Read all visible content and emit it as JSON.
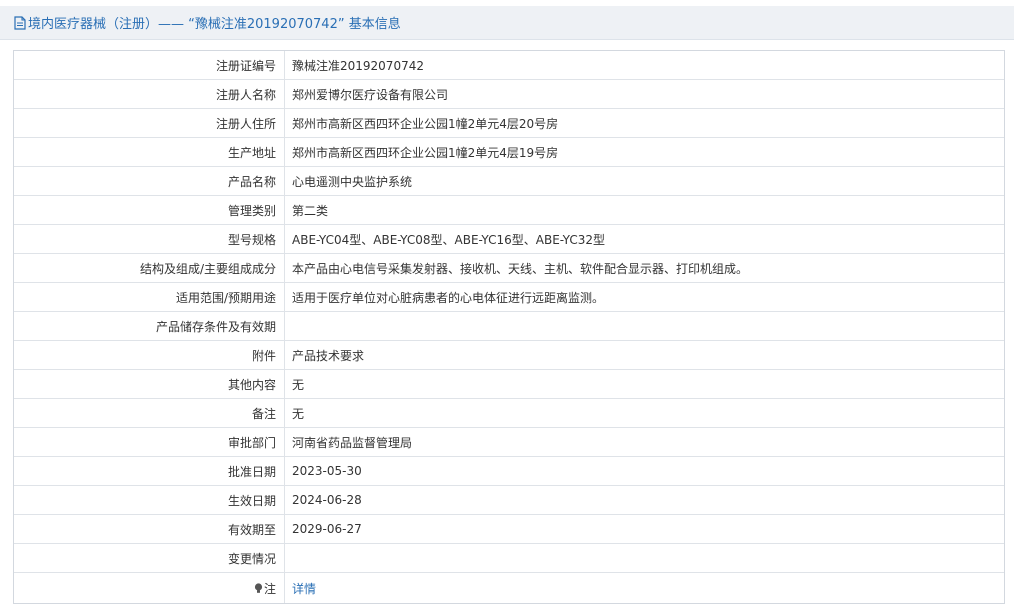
{
  "header": {
    "title": "境内医疗器械（注册）——  “豫械注准20192070742” 基本信息",
    "icon": "document-icon"
  },
  "rows": [
    {
      "label": "注册证编号",
      "value": "豫械注准20192070742"
    },
    {
      "label": "注册人名称",
      "value": "郑州爱博尔医疗设备有限公司"
    },
    {
      "label": "注册人住所",
      "value": "郑州市高新区西四环企业公园1幢2单元4层20号房"
    },
    {
      "label": "生产地址",
      "value": "郑州市高新区西四环企业公园1幢2单元4层19号房"
    },
    {
      "label": "产品名称",
      "value": "心电遥测中央监护系统"
    },
    {
      "label": "管理类别",
      "value": "第二类"
    },
    {
      "label": "型号规格",
      "value": "ABE-YC04型、ABE-YC08型、ABE-YC16型、ABE-YC32型"
    },
    {
      "label": "结构及组成/主要组成成分",
      "value": "本产品由心电信号采集发射器、接收机、天线、主机、软件配合显示器、打印机组成。"
    },
    {
      "label": "适用范围/预期用途",
      "value": "适用于医疗单位对心脏病患者的心电体征进行远距离监测。"
    },
    {
      "label": "产品储存条件及有效期",
      "value": ""
    },
    {
      "label": "附件",
      "value": "产品技术要求"
    },
    {
      "label": "其他内容",
      "value": "无"
    },
    {
      "label": "备注",
      "value": "无"
    },
    {
      "label": "审批部门",
      "value": "河南省药品监督管理局"
    },
    {
      "label": "批准日期",
      "value": "2023-05-30"
    },
    {
      "label": "生效日期",
      "value": "2024-06-28"
    },
    {
      "label": "有效期至",
      "value": "2029-06-27"
    },
    {
      "label": "变更情况",
      "value": ""
    }
  ],
  "note_row": {
    "label": "注",
    "icon": "lightbulb-icon",
    "link_text": "详情"
  },
  "colors": {
    "accent": "#2a6fb5",
    "header_bg": "#eef1f5",
    "border": "#dfe3e8"
  }
}
